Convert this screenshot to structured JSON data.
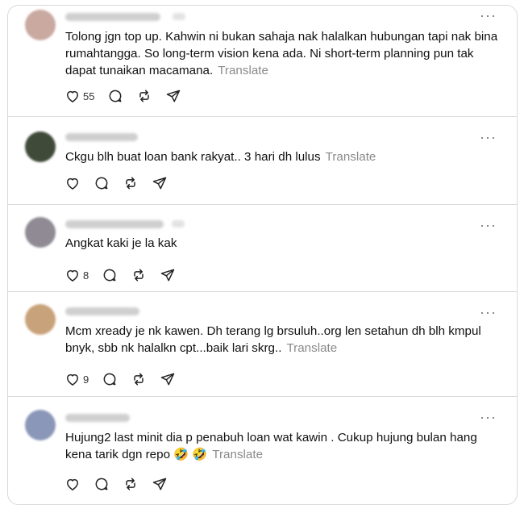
{
  "posts": [
    {
      "avatar_color": "#c9a9a0",
      "text": "Tolong jgn top up. Kahwin ni bukan sahaja nak halalkan hubungan tapi nak bina rumahtangga. So long-term vision kena ada. Ni short-term planning pun tak dapat tunaikan macamana.",
      "translate": "Translate",
      "likes": "55"
    },
    {
      "avatar_color": "#3f4a38",
      "text": "Ckgu blh buat loan bank rakyat.. 3 hari dh lulus",
      "translate": "Translate",
      "likes": ""
    },
    {
      "avatar_color": "#8f8a93",
      "text": "Angkat kaki je la kak",
      "translate": "",
      "likes": "8"
    },
    {
      "avatar_color": "#c8a27a",
      "text": "Mcm xready je nk kawen. Dh terang lg brsuluh..org len setahun dh blh kmpul bnyk, sbb nk halalkn cpt...baik lari skrg..",
      "translate": "Translate",
      "likes": "9"
    },
    {
      "avatar_color": "#8a97b8",
      "text": "Hujung2 last minit dia p penabuh loan wat kawin . Cukup hujung bulan hang kena tarik dgn repo 🤣 🤣",
      "translate": "Translate",
      "likes": ""
    }
  ],
  "icons": {
    "more": "more-icon",
    "like": "heart-icon",
    "reply": "reply-icon",
    "repost": "repost-icon",
    "share": "share-icon"
  },
  "more_glyph": "···"
}
